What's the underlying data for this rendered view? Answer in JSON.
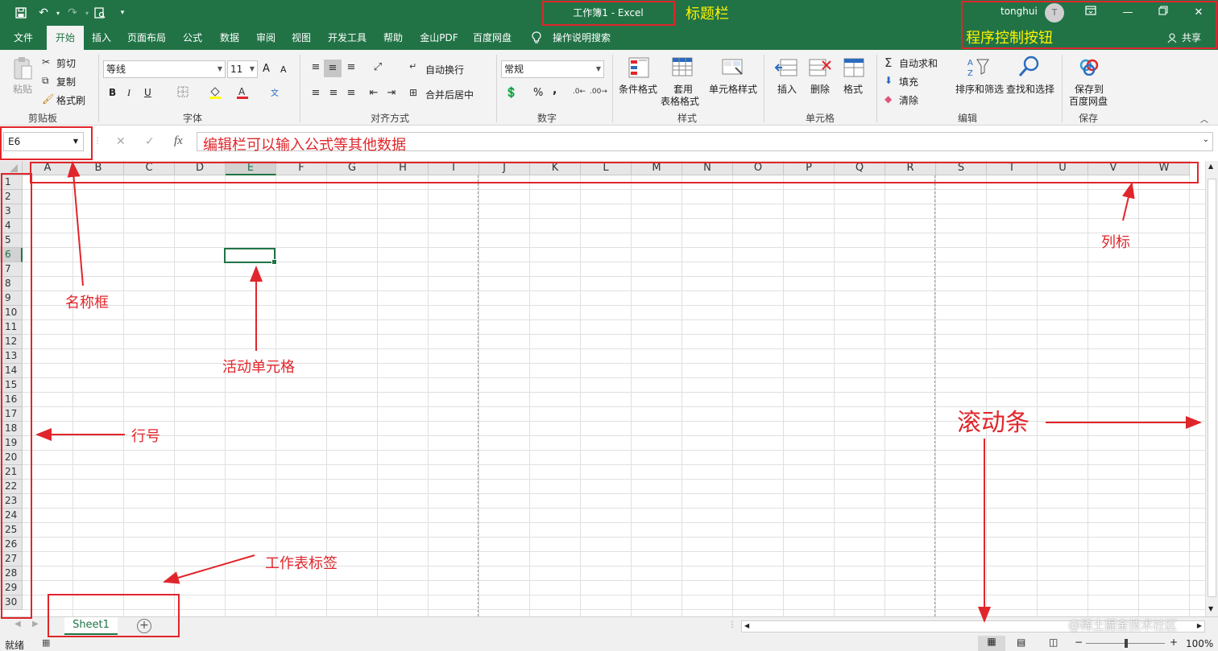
{
  "titlebar": {
    "title": "工作簿1  -  Excel",
    "user": "tonghui",
    "avatar_letter": "T",
    "share_label": "共享"
  },
  "ribbon_tabs": [
    "文件",
    "开始",
    "插入",
    "页面布局",
    "公式",
    "数据",
    "审阅",
    "视图",
    "开发工具",
    "帮助",
    "金山PDF",
    "百度网盘"
  ],
  "active_tab": "开始",
  "tell_me": "操作说明搜索",
  "ribbon": {
    "clipboard": {
      "paste": "粘贴",
      "cut": "剪切",
      "copy": "复制",
      "format_painter": "格式刷",
      "label": "剪贴板"
    },
    "font": {
      "name": "等线",
      "size": "11",
      "bold": "B",
      "italic": "I",
      "underline": "U",
      "grow": "A",
      "shrink": "A",
      "label": "字体"
    },
    "alignment": {
      "wrap": "自动换行",
      "merge": "合并后居中",
      "label": "对齐方式"
    },
    "number": {
      "format": "常规",
      "percent": "%",
      "comma": ",",
      "label": "数字"
    },
    "styles": {
      "conditional": "条件格式",
      "table_line1": "套用",
      "table_line2": "表格格式",
      "cell_styles": "单元格样式",
      "label": "样式"
    },
    "cells": {
      "insert": "插入",
      "delete": "删除",
      "format": "格式",
      "label": "单元格"
    },
    "editing": {
      "autosum": "自动求和",
      "fill": "填充",
      "clear": "清除",
      "sort": "排序和筛选",
      "find": "查找和选择",
      "label": "编辑"
    },
    "save": {
      "line1": "保存到",
      "line2": "百度网盘",
      "label": "保存"
    }
  },
  "formula_bar": {
    "name_box": "E6",
    "fx": "fx",
    "content": ""
  },
  "columns": [
    "A",
    "B",
    "C",
    "D",
    "E",
    "F",
    "G",
    "H",
    "I",
    "J",
    "K",
    "L",
    "M",
    "N",
    "O",
    "P",
    "Q",
    "R",
    "S",
    "T",
    "U",
    "V",
    "W"
  ],
  "rows": [
    "1",
    "2",
    "3",
    "4",
    "5",
    "6",
    "7",
    "8",
    "9",
    "10",
    "11",
    "12",
    "13",
    "14",
    "15",
    "16",
    "17",
    "18",
    "19",
    "20",
    "21",
    "22",
    "23",
    "24",
    "25",
    "26",
    "27",
    "28",
    "29",
    "30"
  ],
  "active_cell": {
    "ref": "E6",
    "column": "E",
    "row": "6"
  },
  "sheets": [
    "Sheet1"
  ],
  "status": {
    "ready": "就绪",
    "zoom": "100%"
  },
  "annotations": {
    "title_bar": "标题栏",
    "controls": "程序控制按钮",
    "formula_edit": "编辑栏可以输入公式等其他数据",
    "name_box": "名称框",
    "column_labels": "列标",
    "active_cell": "活动单元格",
    "row_numbers": "行号",
    "scrollbar": "滚动条",
    "sheet_tab": "工作表标签"
  },
  "watermark": "@稀土掘金技术社区",
  "colors": {
    "excel_green": "#217346",
    "annotation_red": "#e0262b",
    "annotation_yellow": "#fff200"
  }
}
